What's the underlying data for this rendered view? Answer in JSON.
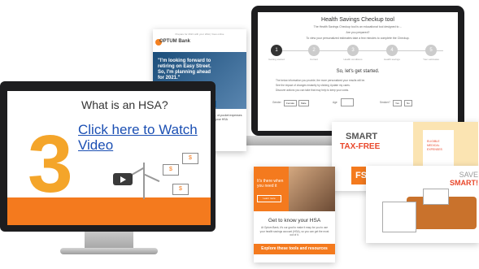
{
  "laptop": {
    "title": "Health Savings Checkup tool",
    "intro": "The Health Savings Checkup tool is an educational tool designed to ...",
    "prepared": "Are you prepared?",
    "subtitle": "To view your personalized estimates take a few minutes to complete the Checkup.",
    "steps": [
      {
        "num": "1",
        "label": "Getting started"
      },
      {
        "num": "2",
        "label": "Current"
      },
      {
        "num": "3",
        "label": "Health conditions"
      },
      {
        "num": "4",
        "label": "Health savings"
      },
      {
        "num": "5",
        "label": "Your estimates"
      }
    ],
    "start_title": "So, let's get started.",
    "line1": "The below information you provide, the more personalized your results will be.",
    "line2": "See the impact of changes instantly by clicking Update my cares.",
    "line3": "Discover actions you can take that may help to keep your costs.",
    "gender_label": "Gender",
    "female": "Female",
    "male": "Male",
    "age_label": "Age",
    "smoker_label": "Smoker?",
    "yes": "Yes",
    "no": "No"
  },
  "email": {
    "top_text": "Prepare for 2021 with your HSA | View online",
    "brand": "OPTUM Bank",
    "hero_text": "\"I'm looking forward to retiring on Easy Street. So, I'm planning ahead for 2021.\"",
    "cta": "Make an HSA contribution",
    "body": "... in 2021 — Make a ... prepare for ... of-pocket expenses or ... retirement. Already ... investing your HSA"
  },
  "monitor": {
    "title": "What is an HSA?",
    "number": "3",
    "link": "Click here to Watch Video",
    "bills": [
      "$",
      "$",
      "$"
    ]
  },
  "smart": {
    "title": "SMART",
    "subtitle": "TAX-FREE",
    "tab": "FS",
    "card_text": "ELIGIBLE MEDICAL EXPENSES"
  },
  "save_smart": {
    "line1": "SAVE",
    "line2": "SMART!"
  },
  "know": {
    "hero_text": "It's there when you need it",
    "hero_btn": "Learn more",
    "title": "Get to know your HSA",
    "body": "At Optum Bank, it's our goal to make it easy for you to use your health savings account (HSA), so you can get the most out of it.",
    "bar": "Explore these tools and resources"
  },
  "colors": {
    "orange": "#f47a1e",
    "link_blue": "#1b4fb3",
    "red": "#e9472b"
  }
}
